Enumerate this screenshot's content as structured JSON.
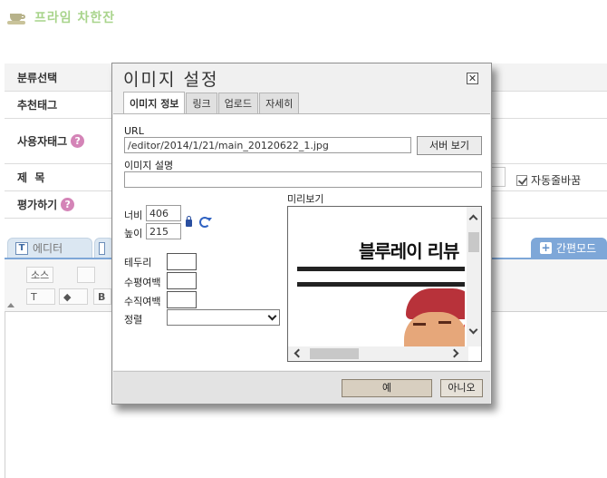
{
  "site": {
    "title": "프라임 차한잔"
  },
  "form": {
    "category_label": "분류선택",
    "recommend_tag_label": "추천태그",
    "user_tag_label": "사용자태그",
    "subject_label": "제  목",
    "rate_label": "평가하기",
    "help_glyph": "?",
    "autowrap_label": "자동줄바꿈"
  },
  "editor": {
    "tab_editor": "에디터",
    "tab_editor_icon": "T",
    "simple_mode": "간편모드",
    "simple_mode_icon": "+",
    "source_btn": "소스",
    "bold_btn": "B",
    "text_color_btn": "T",
    "bg_color_btn": "◆"
  },
  "dialog": {
    "title": "이미지 설정",
    "close_glyph": "✕",
    "tabs": [
      {
        "label": "이미지 정보",
        "active": true
      },
      {
        "label": "링크",
        "active": false
      },
      {
        "label": "업로드",
        "active": false
      },
      {
        "label": "자세히",
        "active": false
      }
    ],
    "url_label": "URL",
    "url_value": "/editor/2014/1/21/main_20120622_1.jpg",
    "server_button": "서버 보기",
    "alt_label": "이미지 설명",
    "alt_value": "",
    "width_label": "너비",
    "width_value": "406",
    "height_label": "높이",
    "height_value": "215",
    "border_label": "테두리",
    "hspace_label": "수평여백",
    "vspace_label": "수직여백",
    "align_label": "정렬",
    "align_value": "",
    "preview_label": "미리보기",
    "preview_image_text": "블루레이 리뷰",
    "ok_button": "예",
    "cancel_button": "아니오"
  }
}
